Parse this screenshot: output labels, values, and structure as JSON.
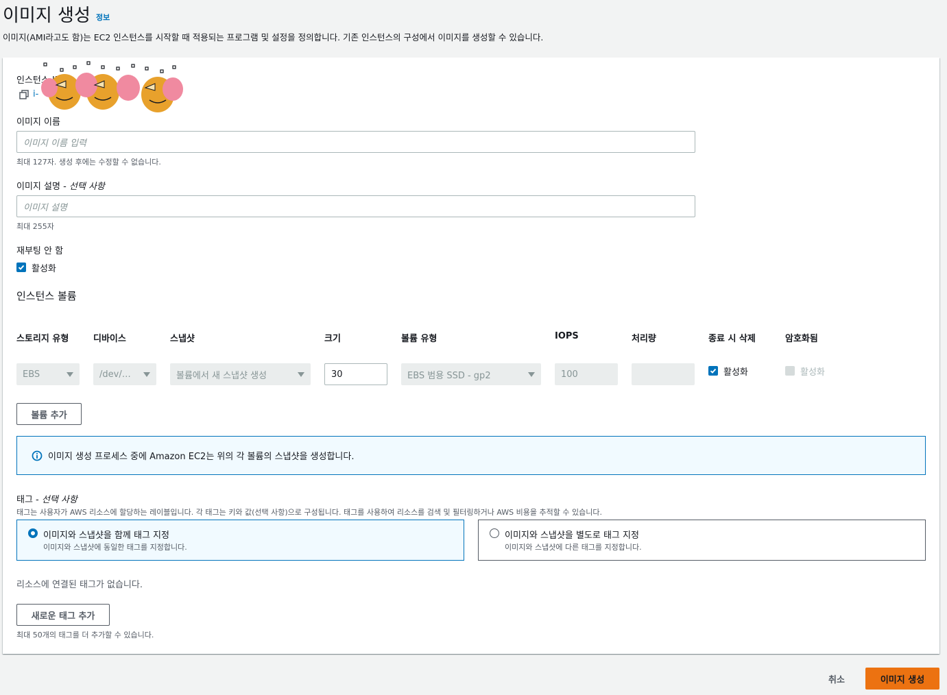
{
  "header": {
    "title": "이미지 생성",
    "info_link": "정보",
    "description": "이미지(AMI라고도 함)는 EC2 인스턴스를 시작할 때 적용되는 프로그램 및 설정을 정의합니다. 기존 인스턴스의 구성에서 이미지를 생성할 수 있습니다."
  },
  "instance": {
    "label": "인스턴스 ID",
    "id_value": "i-"
  },
  "image_name": {
    "label": "이미지 이름",
    "placeholder": "이미지 이름 입력",
    "hint": "최대 127자. 생성 후에는 수정할 수 없습니다."
  },
  "image_description": {
    "label": "이미지 설명 - ",
    "label_optional": "선택 사항",
    "placeholder": "이미지 설명",
    "hint": "최대 255자"
  },
  "no_reboot": {
    "label": "재부팅 안 함",
    "checkbox_label": "활성화",
    "checked": true
  },
  "volumes": {
    "title": "인스턴스 볼륨",
    "columns": [
      "스토리지 유형",
      "디바이스",
      "스냅샷",
      "크기",
      "볼륨 유형",
      "IOPS",
      "처리량",
      "종료 시 삭제",
      "암호화됨"
    ],
    "row": {
      "storage_type": "EBS",
      "device": "/dev/…",
      "snapshot": "볼륨에서 새 스냅샷 생성",
      "size": "30",
      "volume_type": "EBS 범용 SSD - gp2",
      "iops": "100",
      "throughput": "",
      "delete_on_termination": "활성화",
      "encrypted": "활성화"
    },
    "add_volume_button": "볼륨 추가"
  },
  "alert": {
    "text": "이미지 생성 프로세스 중에 Amazon EC2는 위의 각 볼륨의 스냅샷을 생성합니다."
  },
  "tags": {
    "label": "태그 - ",
    "label_optional": "선택 사항",
    "description": "태그는 사용자가 AWS 리소스에 할당하는 레이블입니다. 각 태그는 키와 값(선택 사항)으로 구성됩니다. 태그를 사용하여 리소스를 검색 및 필터링하거나 AWS 비용을 추적할 수 있습니다.",
    "option_together_title": "이미지와 스냅샷을 함께 태그 지정",
    "option_together_desc": "이미지와 스냅샷에 동일한 태그를 지정합니다.",
    "option_separate_title": "이미지와 스냅샷을 별도로 태그 지정",
    "option_separate_desc": "이미지와 스냅샷에 다른 태그를 지정합니다.",
    "selected_option": "together",
    "empty_text": "리소스에 연결된 태그가 없습니다.",
    "add_tag_button": "새로운 태그 추가",
    "limit_hint": "최대 50개의 태그를 더 추가할 수 있습니다."
  },
  "footer": {
    "cancel": "취소",
    "create": "이미지 생성"
  },
  "colors": {
    "accent": "#0073bb",
    "primary_button": "#ec7211"
  }
}
